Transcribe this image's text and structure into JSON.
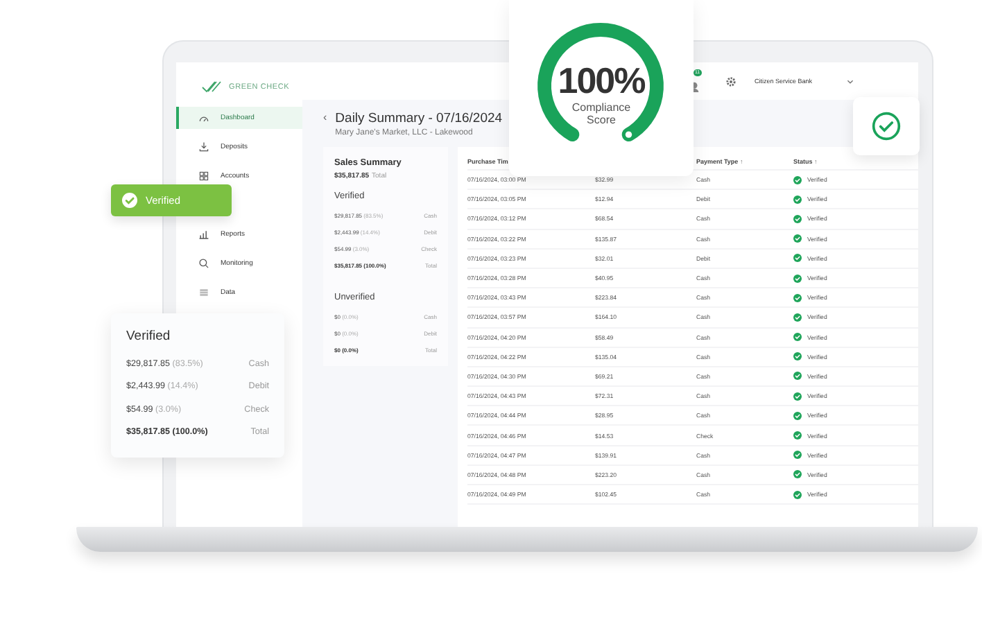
{
  "brand": {
    "name": "GREEN CHECK"
  },
  "sidebar": {
    "items": [
      {
        "label": "Dashboard",
        "kind": "dashboard",
        "selected": true
      },
      {
        "label": "Deposits",
        "kind": "deposits",
        "selected": false
      },
      {
        "label": "Accounts",
        "kind": "accounts",
        "selected": false
      },
      {
        "label": "Reports",
        "kind": "reports",
        "selected": false
      },
      {
        "label": "Monitoring",
        "kind": "monitoring",
        "selected": false
      },
      {
        "label": "Data",
        "kind": "data",
        "selected": false
      }
    ]
  },
  "topbar": {
    "notifications": "11",
    "bank": "Citizen Service Bank"
  },
  "page": {
    "back": "‹",
    "title": "Daily Summary  - 07/16/2024",
    "subtitle": "Mary Jane's Market, LLC - Lakewood"
  },
  "summary": {
    "title": "Sales Summary",
    "total": "$35,817.85",
    "total_label": "Total",
    "sections": [
      {
        "title": "Verified",
        "rows": [
          {
            "amount": "$29,817.85",
            "percent": "(83.5%)",
            "type": "Cash",
            "kind": "line"
          },
          {
            "amount": "$2,443.99",
            "percent": "(14.4%)",
            "type": "Debit",
            "kind": "line"
          },
          {
            "amount": "$54.99",
            "percent": "(3.0%)",
            "type": "Check",
            "kind": "line"
          },
          {
            "amount": "$35,817.85",
            "percent": "(100.0%)",
            "type": "Total",
            "kind": "total"
          }
        ]
      },
      {
        "title": "Unverified",
        "rows": [
          {
            "amount": "$0",
            "percent": "(0.0%)",
            "type": "Cash",
            "kind": "line"
          },
          {
            "amount": "$0",
            "percent": "(0.0%)",
            "type": "Debit",
            "kind": "line"
          },
          {
            "amount": "$0",
            "percent": "(0.0%)",
            "type": "Total",
            "kind": "total"
          }
        ]
      }
    ]
  },
  "table": {
    "columns": [
      {
        "kind": "time",
        "label": "Purchase Tim"
      },
      {
        "kind": "type",
        "label": "Payment Type",
        "sort_arrow": "↑"
      },
      {
        "kind": "status",
        "label": "Status",
        "sort_arrow": "↑"
      }
    ],
    "rows": [
      {
        "time": "07/16/2024, 03:00 PM",
        "amount": "$32.99",
        "type": "Cash",
        "status": "Verified",
        "verified": true
      },
      {
        "time": "07/16/2024, 03:05 PM",
        "amount": "$12.94",
        "type": "Debit",
        "status": "Verified",
        "verified": true
      },
      {
        "time": "07/16/2024, 03:12 PM",
        "amount": "$68.54",
        "type": "Cash",
        "status": "Verified",
        "verified": true
      },
      {
        "time": "07/16/2024, 03:22 PM",
        "amount": "$135.87",
        "type": "Cash",
        "status": "Verified",
        "verified": true
      },
      {
        "time": "07/16/2024, 03:23 PM",
        "amount": "$32.01",
        "type": "Debit",
        "status": "Verified",
        "verified": true
      },
      {
        "time": "07/16/2024, 03:28 PM",
        "amount": "$40.95",
        "type": "Cash",
        "status": "Verified",
        "verified": true
      },
      {
        "time": "07/16/2024, 03:43 PM",
        "amount": "$223.84",
        "type": "Cash",
        "status": "Verified",
        "verified": true
      },
      {
        "time": "07/16/2024, 03:57 PM",
        "amount": "$164.10",
        "type": "Cash",
        "status": "Verified",
        "verified": true
      },
      {
        "time": "07/16/2024, 04:20 PM",
        "amount": "$58.49",
        "type": "Cash",
        "status": "Verified",
        "verified": true
      },
      {
        "time": "07/16/2024, 04:22 PM",
        "amount": "$135.04",
        "type": "Cash",
        "status": "Verified",
        "verified": true
      },
      {
        "time": "07/16/2024, 04:30 PM",
        "amount": "$69.21",
        "type": "Cash",
        "status": "Verified",
        "verified": true
      },
      {
        "time": "07/16/2024, 04:43 PM",
        "amount": "$72.31",
        "type": "Cash",
        "status": "Verified",
        "verified": true
      },
      {
        "time": "07/16/2024, 04:44 PM",
        "amount": "$28.95",
        "type": "Cash",
        "status": "Verified",
        "verified": true
      },
      {
        "time": "07/16/2024, 04:46 PM",
        "amount": "$14.53",
        "type": "Check",
        "status": "Verified",
        "verified": true
      },
      {
        "time": "07/16/2024, 04:47 PM",
        "amount": "$139.91",
        "type": "Cash",
        "status": "Verified",
        "verified": true
      },
      {
        "time": "07/16/2024, 04:48 PM",
        "amount": "$223.20",
        "type": "Cash",
        "status": "Verified",
        "verified": true
      },
      {
        "time": "07/16/2024, 04:49 PM",
        "amount": "$102.45",
        "type": "Cash",
        "status": "Verified",
        "verified": true
      }
    ]
  },
  "score_card": {
    "value": "100%",
    "label": "Compliance Score",
    "level": 1.0
  },
  "verified_badge": {
    "label": "Verified"
  },
  "verified_card": {
    "title": "Verified",
    "rows": [
      {
        "amount": "$29,817.85",
        "percent": "(83.5%)",
        "type": "Cash",
        "kind": "line"
      },
      {
        "amount": "$2,443.99",
        "percent": "(14.4%)",
        "type": "Debit",
        "kind": "line"
      },
      {
        "amount": "$54.99",
        "percent": "(3.0%)",
        "type": "Check",
        "kind": "line"
      },
      {
        "amount": "$35,817.85",
        "percent": "(100.0%)",
        "type": "Total",
        "kind": "total"
      }
    ]
  }
}
